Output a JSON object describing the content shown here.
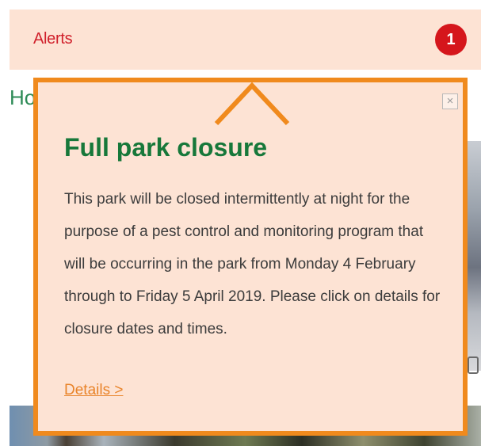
{
  "alerts": {
    "label": "Alerts",
    "count": "1"
  },
  "background": {
    "partial_heading": "Ho"
  },
  "popup": {
    "close_symbol": "×",
    "title": "Full park closure",
    "body": "This park will be closed intermittently at night for the purpose of a pest control and monitoring program that will be occurring in the park from Monday 4 February through to Friday 5 April 2019. Please click on details for closure dates and times.",
    "details_link": "Details >"
  },
  "colors": {
    "alert_bar_bg": "#fde3d4",
    "alert_text": "#d0202b",
    "badge_bg": "#d5161c",
    "popup_border": "#f08a1d",
    "title_green": "#17783a",
    "link_orange": "#e9842a"
  }
}
